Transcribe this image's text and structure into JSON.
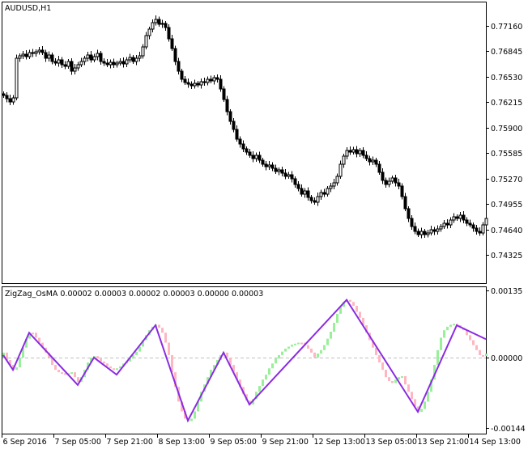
{
  "colors": {
    "background": "#ffffff",
    "axis": "#000000",
    "bull": "#ffffff",
    "bear": "#000000",
    "zigzag": "#8a2be2",
    "hist_up": "#98f098",
    "hist_down": "#ffb6c1",
    "zero_line": "#c0c0c0"
  },
  "chart_data": [
    {
      "type": "candlestick",
      "title": "AUDUSD,H1",
      "price_ticks": [
        "0.77160",
        "0.76845",
        "0.76530",
        "0.76215",
        "0.75900",
        "0.75585",
        "0.75270",
        "0.74955",
        "0.74640",
        "0.74325"
      ],
      "price_tick_values": [
        0.7716,
        0.76845,
        0.7653,
        0.76215,
        0.759,
        0.75585,
        0.7527,
        0.74955,
        0.7464,
        0.74325
      ],
      "first_open": 0.7632,
      "closes": [
        0.763,
        0.7626,
        0.7622,
        0.7627,
        0.7676,
        0.7679,
        0.7681,
        0.7678,
        0.7683,
        0.7682,
        0.7684,
        0.7686,
        0.7683,
        0.7676,
        0.768,
        0.7672,
        0.767,
        0.7674,
        0.7668,
        0.7666,
        0.7672,
        0.766,
        0.7664,
        0.7668,
        0.7672,
        0.7676,
        0.768,
        0.7674,
        0.7678,
        0.7682,
        0.7672,
        0.767,
        0.7668,
        0.7671,
        0.7668,
        0.767,
        0.7672,
        0.7669,
        0.7674,
        0.7677,
        0.7672,
        0.7676,
        0.7679,
        0.769,
        0.7704,
        0.7712,
        0.772,
        0.7724,
        0.7718,
        0.7719,
        0.7714,
        0.77,
        0.7688,
        0.7672,
        0.766,
        0.765,
        0.7646,
        0.7644,
        0.7642,
        0.7645,
        0.7643,
        0.7647,
        0.7646,
        0.765,
        0.7648,
        0.7652,
        0.765,
        0.7638,
        0.7625,
        0.761,
        0.7598,
        0.7588,
        0.7576,
        0.757,
        0.7564,
        0.756,
        0.7556,
        0.7552,
        0.7556,
        0.755,
        0.7545,
        0.7542,
        0.7544,
        0.754,
        0.7536,
        0.7538,
        0.7534,
        0.753,
        0.7532,
        0.7527,
        0.752,
        0.7515,
        0.7508,
        0.7512,
        0.7504,
        0.75,
        0.7498,
        0.7505,
        0.751,
        0.7508,
        0.7515,
        0.7518,
        0.7522,
        0.753,
        0.7545,
        0.7555,
        0.7562,
        0.756,
        0.7563,
        0.7558,
        0.7562,
        0.7556,
        0.7552,
        0.7548,
        0.755,
        0.7545,
        0.7535,
        0.7525,
        0.752,
        0.7524,
        0.7528,
        0.7522,
        0.7518,
        0.7505,
        0.749,
        0.7478,
        0.7468,
        0.7462,
        0.7458,
        0.7462,
        0.7458,
        0.746,
        0.7464,
        0.7462,
        0.7465,
        0.7468,
        0.7472,
        0.747,
        0.7476,
        0.748,
        0.7478,
        0.7482,
        0.7476,
        0.7472,
        0.747,
        0.7466,
        0.7462,
        0.746,
        0.747,
        0.7478
      ]
    },
    {
      "type": "bar",
      "title": "ZigZag_OsMA 0.00002 0.00003 0.00002 0.00003 0.00000 0.00003",
      "value_unit": 1e-05,
      "y_ticks": [
        "0.00135",
        "0.00000",
        "-0.00144"
      ],
      "ylim": [
        -0.00144,
        0.00135
      ],
      "histogram": [
        10,
        -5,
        -15,
        -25,
        -20,
        0,
        20,
        38,
        50,
        50,
        40,
        30,
        20,
        10,
        0,
        -15,
        -25,
        -30,
        -32,
        -33,
        -32,
        -30,
        -40,
        -50,
        -40,
        -25,
        -10,
        0,
        3,
        -2,
        -8,
        -12,
        -18,
        -22,
        -25,
        -22,
        -18,
        -12,
        -8,
        -2,
        5,
        12,
        22,
        35,
        45,
        55,
        62,
        66,
        60,
        50,
        30,
        5,
        -30,
        -60,
        -90,
        -110,
        -125,
        -130,
        -125,
        -110,
        -90,
        -70,
        -55,
        -40,
        -25,
        -15,
        -5,
        5,
        10,
        0,
        -15,
        -30,
        -45,
        -60,
        -75,
        -88,
        -96,
        -85,
        -70,
        -58,
        -45,
        -35,
        -22,
        -12,
        -2,
        5,
        12,
        18,
        22,
        26,
        28,
        30,
        30,
        25,
        18,
        10,
        0,
        8,
        15,
        25,
        38,
        52,
        70,
        88,
        102,
        112,
        116,
        112,
        104,
        92,
        80,
        65,
        50,
        35,
        20,
        5,
        -10,
        -25,
        -40,
        -48,
        -52,
        -45,
        -40,
        -38,
        -55,
        -70,
        -85,
        -100,
        -111,
        -105,
        -90,
        -70,
        -45,
        -15,
        15,
        40,
        55,
        62,
        66,
        68,
        65,
        60,
        55,
        45,
        35,
        25,
        15,
        5,
        3,
        8
      ],
      "zigzag": [
        [
          0,
          5
        ],
        [
          3,
          -25
        ],
        [
          8,
          50
        ],
        [
          23,
          -56
        ],
        [
          28,
          0
        ],
        [
          35,
          -35
        ],
        [
          47,
          65
        ],
        [
          57,
          -129
        ],
        [
          68,
          10
        ],
        [
          76,
          -96
        ],
        [
          106,
          116
        ],
        [
          128,
          -111
        ],
        [
          140,
          65
        ],
        [
          149,
          37
        ]
      ]
    }
  ],
  "time_axis": {
    "labels": [
      "6 Sep 2016",
      "7 Sep 05:00",
      "7 Sep 21:00",
      "8 Sep 13:00",
      "9 Sep 05:00",
      "9 Sep 21:00",
      "12 Sep 13:00",
      "13 Sep 05:00",
      "13 Sep 21:00",
      "14 Sep 13:00"
    ],
    "bar_index": [
      0,
      16,
      32,
      48,
      64,
      80,
      96,
      112,
      128,
      144
    ]
  }
}
